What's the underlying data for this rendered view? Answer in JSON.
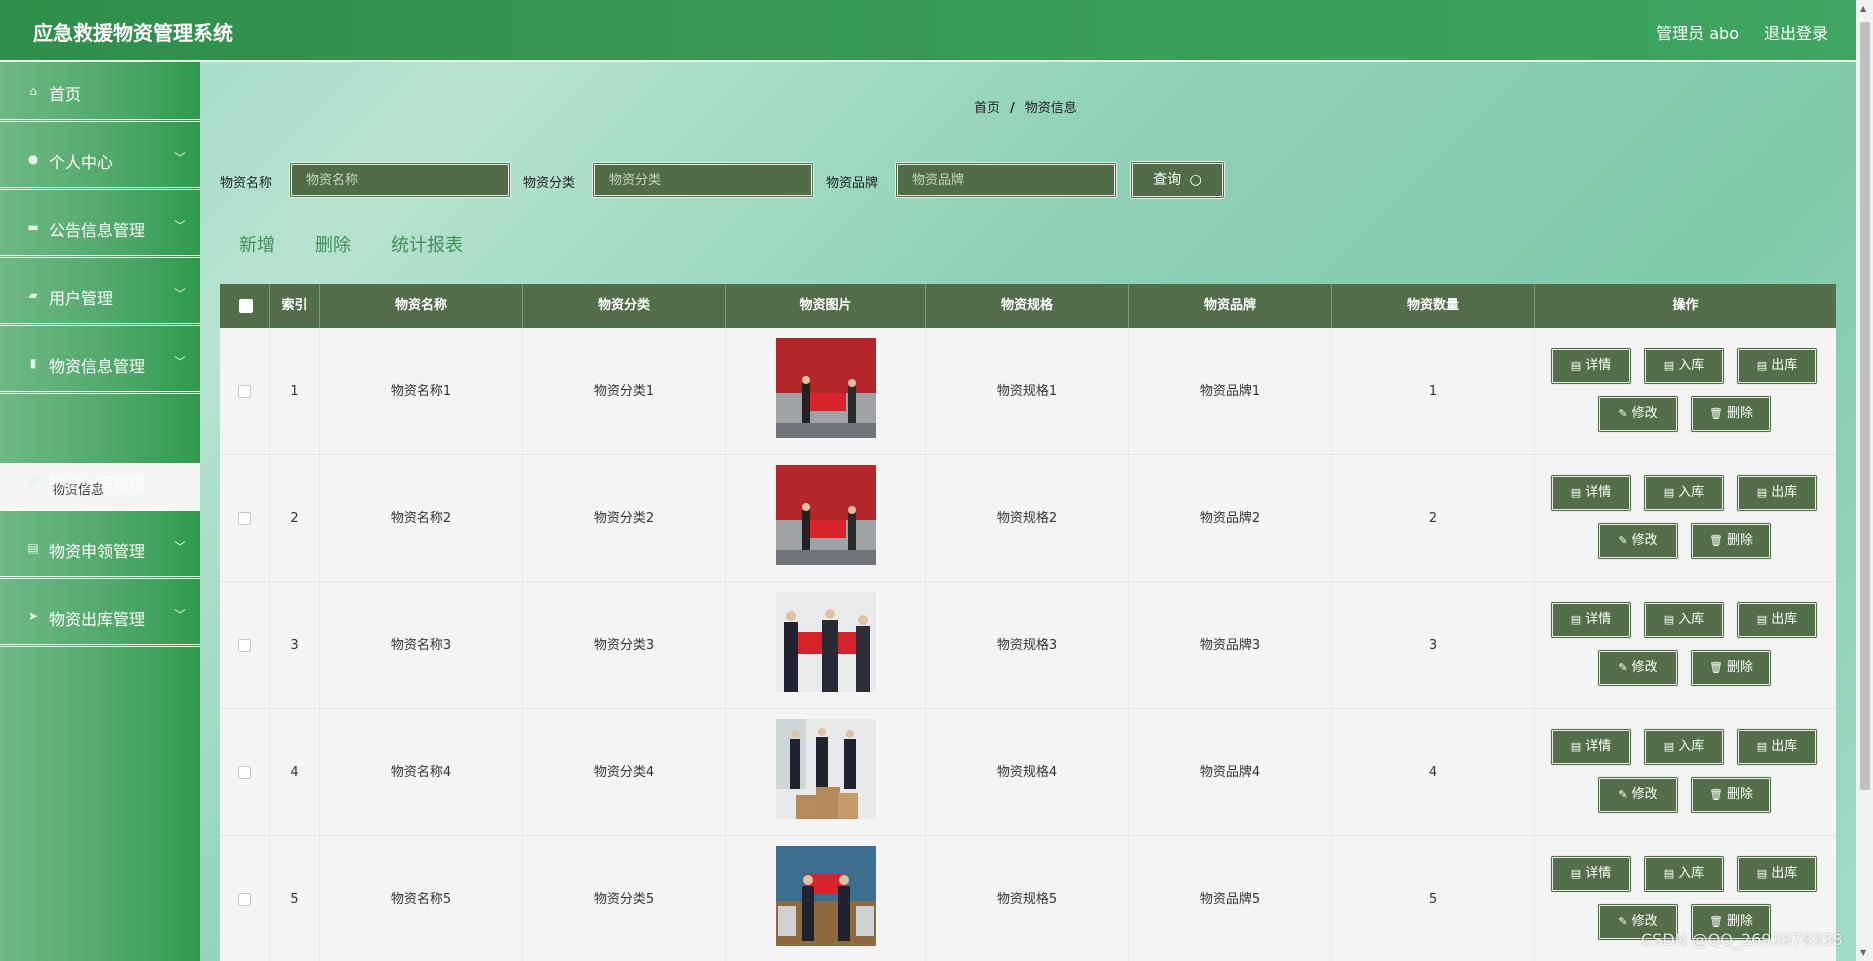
{
  "app": {
    "title": "应急救援物资管理系统",
    "user": "管理员 abo",
    "logout": "退出登录"
  },
  "sidebar": {
    "items": [
      {
        "label": "首页",
        "icon": "home-icon"
      },
      {
        "label": "个人中心",
        "icon": "user-icon"
      },
      {
        "label": "公告信息管理",
        "icon": "notice-icon"
      },
      {
        "label": "用户管理",
        "icon": "chat-icon"
      },
      {
        "label": "物资信息管理",
        "icon": "chart-icon"
      },
      {
        "label": "物资入库管理",
        "icon": "grid-icon"
      },
      {
        "label": "物资申领管理",
        "icon": "clipboard-icon"
      },
      {
        "label": "物资出库管理",
        "icon": "send-icon"
      }
    ],
    "active_sub": "物资信息"
  },
  "breadcrumb": {
    "home": "首页",
    "sep": "/",
    "current": "物资信息"
  },
  "search": {
    "name_label": "物资名称",
    "name_placeholder": "物资名称",
    "category_label": "物资分类",
    "category_placeholder": "物资分类",
    "brand_label": "物资品牌",
    "brand_placeholder": "物资品牌",
    "button": "查询"
  },
  "actions": {
    "add": "新增",
    "delete": "删除",
    "report": "统计报表"
  },
  "table": {
    "headers": [
      "索引",
      "物资名称",
      "物资分类",
      "物资图片",
      "物资规格",
      "物资品牌",
      "物资数量",
      "操作"
    ],
    "rows": [
      {
        "index": "1",
        "name": "物资名称1",
        "category": "物资分类1",
        "spec": "物资规格1",
        "brand": "物资品牌1",
        "qty": "1"
      },
      {
        "index": "2",
        "name": "物资名称2",
        "category": "物资分类2",
        "spec": "物资规格2",
        "brand": "物资品牌2",
        "qty": "2"
      },
      {
        "index": "3",
        "name": "物资名称3",
        "category": "物资分类3",
        "spec": "物资规格3",
        "brand": "物资品牌3",
        "qty": "3"
      },
      {
        "index": "4",
        "name": "物资名称4",
        "category": "物资分类4",
        "spec": "物资规格4",
        "brand": "物资品牌4",
        "qty": "4"
      },
      {
        "index": "5",
        "name": "物资名称5",
        "category": "物资分类5",
        "spec": "物资规格5",
        "brand": "物资品牌5",
        "qty": "5"
      }
    ],
    "buttons": {
      "detail": "详情",
      "in": "入库",
      "out": "出库",
      "edit": "修改",
      "del": "删除"
    }
  },
  "watermark": "CSDN @QQ_2693978338",
  "colors": {
    "topbar": "#3a9d59",
    "table_header": "#536e48",
    "button": "#536e48",
    "accent_link": "#3f8f58"
  }
}
